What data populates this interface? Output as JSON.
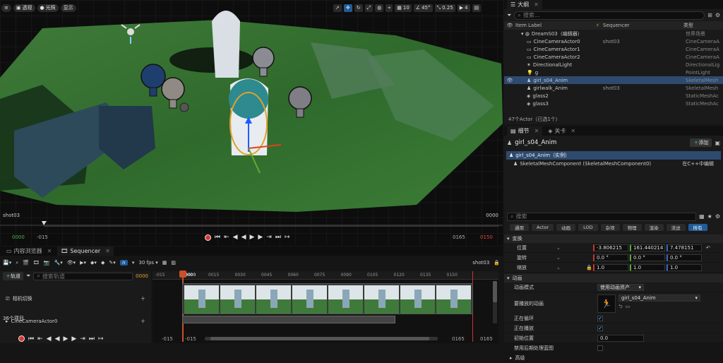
{
  "viewport": {
    "perspective_label": "透视",
    "lit_label": "光照",
    "show_label": "显示",
    "grid_snap": "10",
    "rotation_snap": "45°",
    "scale_snap": "0.25",
    "camera_speed": "4",
    "shot_label": "shot03",
    "frame_right": "0000",
    "timeline": {
      "in_frame": "0000",
      "start": "-015",
      "end": "0165",
      "out_frame": "0150"
    }
  },
  "outliner": {
    "tab_label": "大纲",
    "search_placeholder": "搜索...",
    "col_item_label": "Item Label",
    "col_sequencer": "Sequencer",
    "col_type": "类型",
    "rows": [
      {
        "label": "DreamS03（编辑器）",
        "seq": "",
        "type": "世界场景",
        "icon": "world-icon",
        "indent": 1,
        "selected": false,
        "eye": false
      },
      {
        "label": "CineCameraActor0",
        "seq": "shot03",
        "type": "CineCameraA",
        "icon": "camera-icon",
        "indent": 2,
        "selected": false,
        "eye": false
      },
      {
        "label": "CineCameraActor1",
        "seq": "",
        "type": "CineCameraA",
        "icon": "camera-icon",
        "indent": 2,
        "selected": false,
        "eye": false
      },
      {
        "label": "CineCameraActor2",
        "seq": "",
        "type": "CineCameraA",
        "icon": "camera-icon",
        "indent": 2,
        "selected": false,
        "eye": false
      },
      {
        "label": "DirectionalLight",
        "seq": "",
        "type": "DirectionalLig",
        "icon": "directional-light-icon",
        "indent": 2,
        "selected": false,
        "eye": false
      },
      {
        "label": "g",
        "seq": "",
        "type": "PointLight",
        "icon": "point-light-icon",
        "indent": 2,
        "selected": false,
        "eye": false
      },
      {
        "label": "girl_s04_Anim",
        "seq": "",
        "type": "SkeletalMesh",
        "icon": "skeletal-mesh-icon",
        "indent": 2,
        "selected": true,
        "eye": true
      },
      {
        "label": "girlwalk_Anim",
        "seq": "shot03",
        "type": "SkeletalMesh",
        "icon": "skeletal-mesh-icon",
        "indent": 2,
        "selected": false,
        "eye": false
      },
      {
        "label": "glass2",
        "seq": "",
        "type": "StaticMeshAc",
        "icon": "static-mesh-icon",
        "indent": 2,
        "selected": false,
        "eye": false
      },
      {
        "label": "glass3",
        "seq": "",
        "type": "StaticMeshAc",
        "icon": "static-mesh-icon",
        "indent": 2,
        "selected": false,
        "eye": false
      }
    ],
    "footer": "47个Actor（已选1个）"
  },
  "details": {
    "tab_details": "细节",
    "tab_levels": "关卡",
    "actor_name": "girl_s04_Anim",
    "add_label": "添加",
    "instance_label": "girl_s04_Anim（实例）",
    "component_label": "SkeletalMeshComponent (SkeletalMeshComponent0)",
    "cpp_link": "在C++中编辑",
    "search_placeholder": "搜索",
    "categories": [
      "通用",
      "Actor",
      "动画",
      "LOD",
      "杂项",
      "物理",
      "渲染",
      "流送",
      "所有"
    ],
    "transform_label": "变换",
    "location_label": "位置",
    "location": [
      "-3.806215",
      "161.440214",
      "7.478151"
    ],
    "rotation_label": "旋转",
    "rotation": [
      "0.0 °",
      "0.0 °",
      "0.0 °"
    ],
    "scale_label": "缩放",
    "scale": [
      "1.0",
      "1.0",
      "1.0"
    ],
    "animation_section": "动画",
    "anim_mode_label": "动画模式",
    "anim_mode_value": "使用动画资产",
    "anim_to_play_label": "要播放的动画",
    "anim_asset": "girl_s04_Anim",
    "looping_label": "正在循环",
    "playing_label": "正在播放",
    "initial_pos_label": "初始位置",
    "initial_pos_value": "0.0",
    "disable_post_label": "禁用后期处理蓝图",
    "advanced_label": "高级"
  },
  "sequencer": {
    "tab_content": "内容浏览器",
    "tab_sequencer": "Sequencer",
    "fps": "30 fps",
    "shot_name": "shot03",
    "add_track": "轨道",
    "search_placeholder": "搜索轨道",
    "current_frame": "0000",
    "ruler_marks": [
      "-015",
      "0000",
      "0015",
      "0030",
      "0045",
      "0060",
      "0075",
      "0090",
      "0105",
      "0120",
      "0135",
      "0150"
    ],
    "playhead_frame": "0000",
    "camera_cuts": "相机切换",
    "track_actor": "CineCameraActor0",
    "item_count": "36个项目",
    "bottom_start": "-015",
    "bottom_start2": "-015",
    "bottom_end": "0165",
    "bottom_out": "0165"
  }
}
